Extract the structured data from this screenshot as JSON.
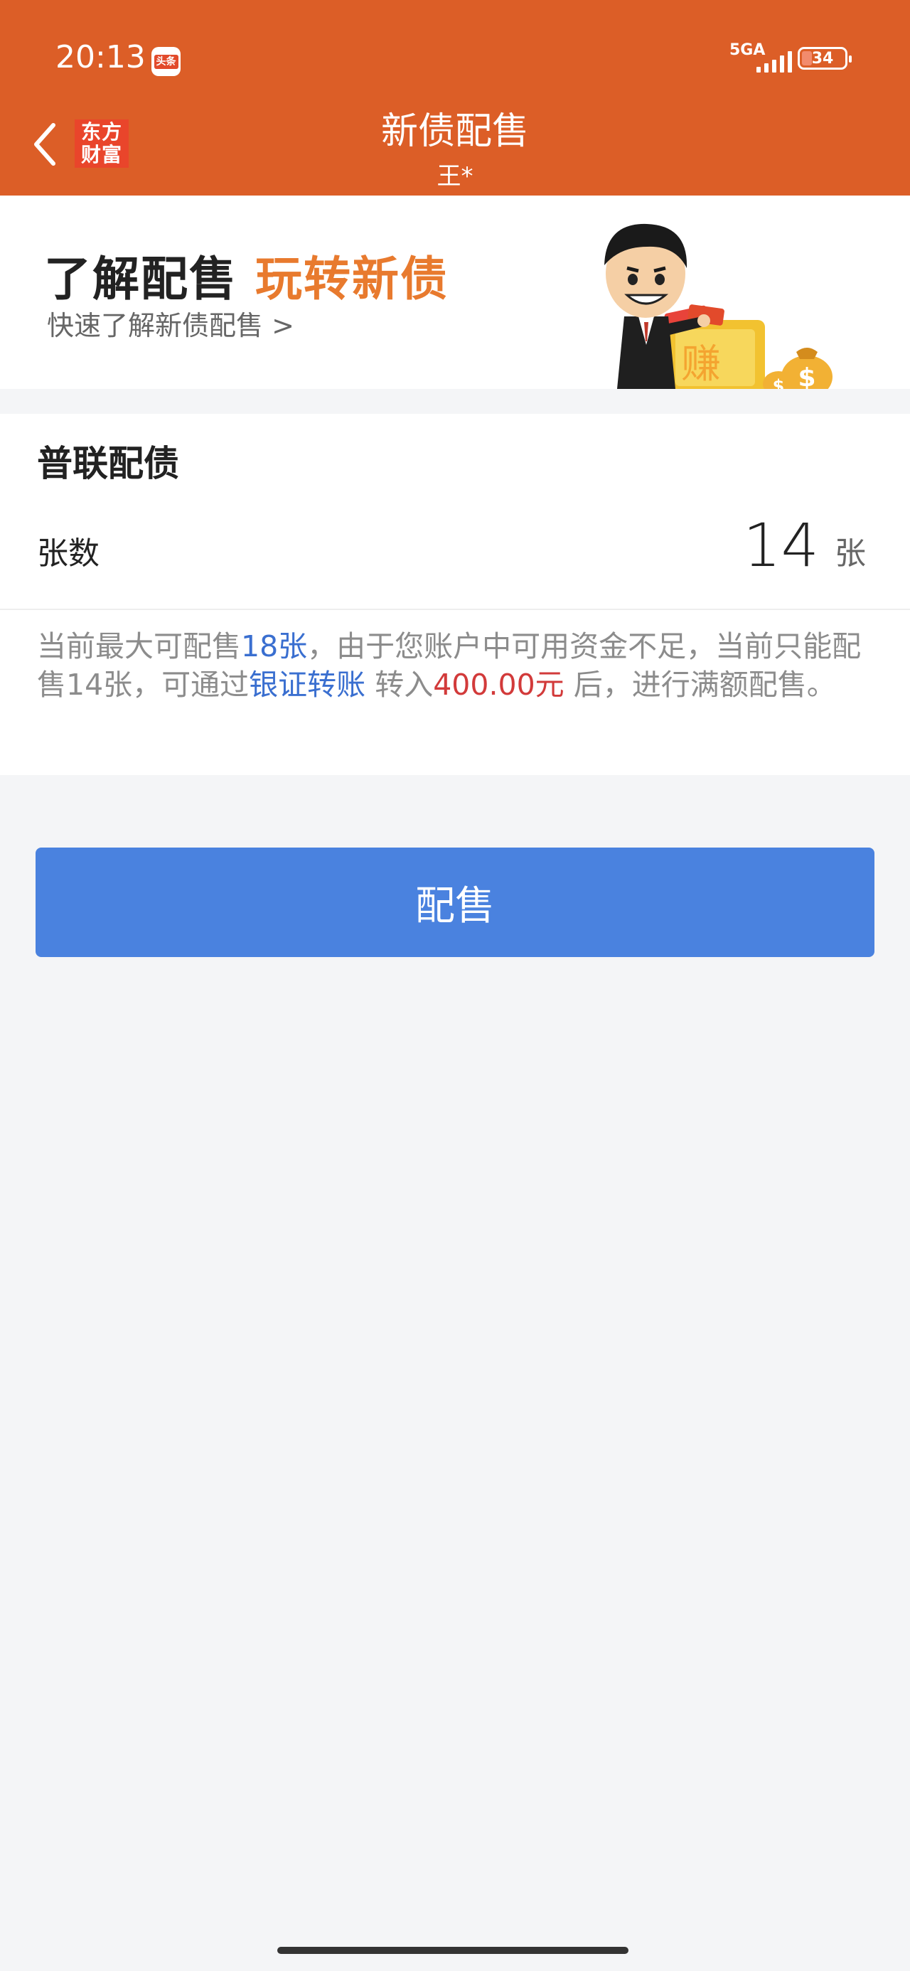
{
  "status_bar": {
    "time": "20:13",
    "news_badge": "头条",
    "network": "5GA",
    "battery": "34"
  },
  "header": {
    "brand_logo": [
      "东方",
      "财富"
    ],
    "title": "新债配售",
    "subtitle": "王*"
  },
  "banner": {
    "title_main": "了解配售",
    "title_highlight": "玩转新债",
    "link": "快速了解新债配售 >",
    "art_text": "赚"
  },
  "product": {
    "name": "普联配债",
    "quantity_label": "张数",
    "quantity_value": "14",
    "quantity_unit": "张"
  },
  "notice": {
    "part1": "当前最大可配售",
    "max_qty": "18张",
    "part2": "，由于您账户中可用资金不足，当前只能配售14张，可通过",
    "transfer_link": "银证转账",
    "part3": " 转入",
    "amount": "400.00元",
    "part4": " 后，进行满额配售。"
  },
  "actions": {
    "allot_label": "配售"
  },
  "colors": {
    "header_bg": "#dc5e27",
    "brand_red": "#e9452b",
    "highlight_orange": "#e87a2e",
    "button_blue": "#4a82df",
    "link_blue": "#3a6fd0",
    "amount_red": "#d23a3a",
    "page_bg": "#f4f5f7"
  },
  "icons": {
    "back": "chevron-left-icon",
    "signal": "signal-bars-icon",
    "battery": "battery-icon"
  }
}
